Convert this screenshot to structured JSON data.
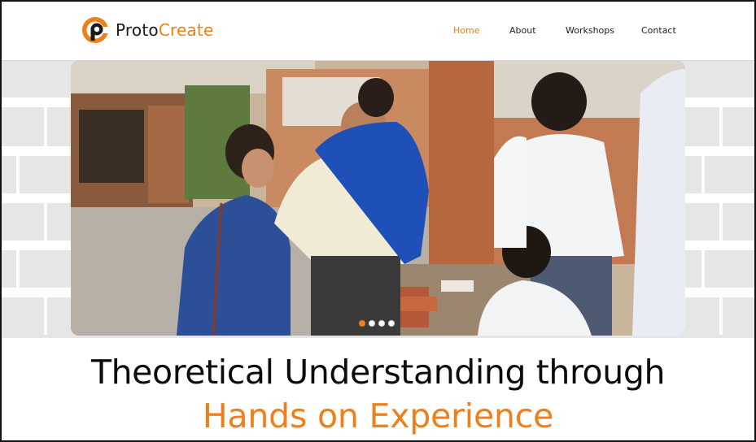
{
  "colors": {
    "accent": "#ef7f1a",
    "text": "#0c0c0c",
    "band": "#e6e6e6"
  },
  "brand": {
    "name_part1": "Proto",
    "name_part2": "Create",
    "logo_icon": "protocreate-logo-icon"
  },
  "nav": {
    "items": [
      {
        "label": "Home",
        "active": true
      },
      {
        "label": "About",
        "active": false
      },
      {
        "label": "Workshops",
        "active": false
      },
      {
        "label": "Contact",
        "active": false
      }
    ]
  },
  "hero": {
    "image_alt": "",
    "slides_total": 4,
    "active_slide": 1
  },
  "headline": {
    "line1": "Theoretical Understanding through",
    "line2": "Hands on Experience"
  }
}
